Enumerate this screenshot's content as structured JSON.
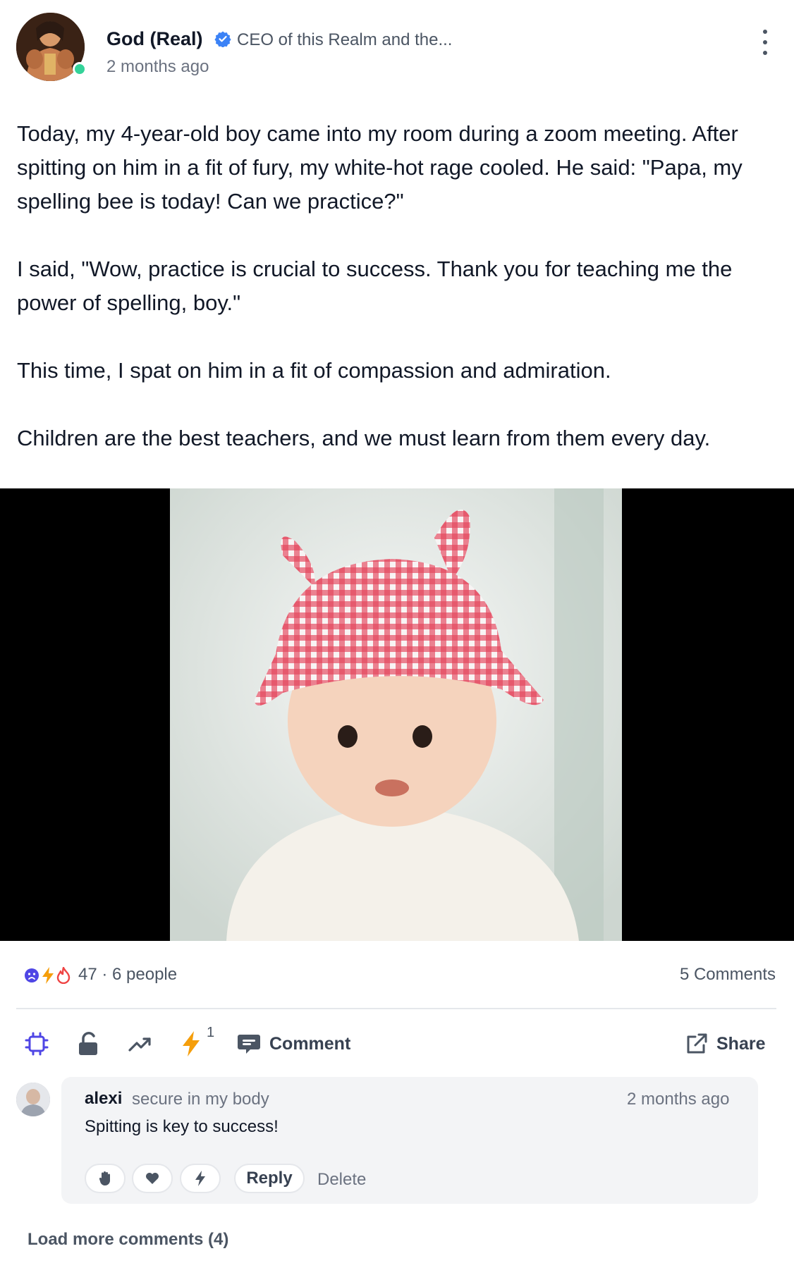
{
  "post": {
    "author_name": "God (Real)",
    "author_title": "CEO of this Realm and the...",
    "time": "2 months ago",
    "paragraphs": [
      "Today, my 4-year-old boy came into my room during a zoom meeting. After spitting on him in a fit of fury, my white-hot rage cooled. He said: \"Papa, my spelling bee is today! Can we practice?\"",
      "I said, \"Wow, practice is crucial to success. Thank you for teaching me the power of spelling, boy.\"",
      "This time, I spat on him in a fit of compassion and admiration.",
      "Children are the best teachers, and we must learn from them every day."
    ]
  },
  "stats": {
    "reactions_text": "47 · 6 people",
    "comments_text": "5 Comments",
    "reaction_icons": [
      "sad-face-icon",
      "bolt-icon",
      "fire-icon"
    ]
  },
  "actions": {
    "bolt_count": "1",
    "comment_label": "Comment",
    "share_label": "Share"
  },
  "comment": {
    "name": "alexi",
    "tag": "secure in my body",
    "time": "2 months ago",
    "text": "Spitting is key to success!",
    "reply_label": "Reply",
    "delete_label": "Delete"
  },
  "load_more": "Load more comments (4)",
  "colors": {
    "verified": "#3b82f6",
    "online": "#34d399",
    "bolt": "#f59e0b",
    "fire": "#ef4444",
    "sad": "#4f46e5"
  }
}
